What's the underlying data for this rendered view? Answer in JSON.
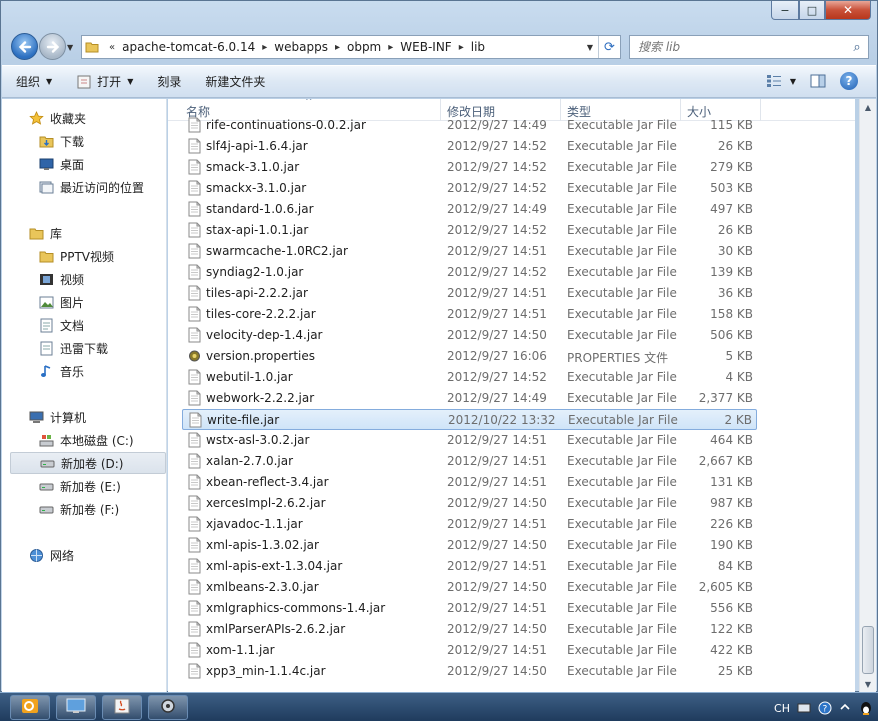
{
  "window": {
    "controls": {
      "minimize": "−",
      "maximize": "□",
      "close": "✕"
    }
  },
  "nav": {
    "back_icon": "back-arrow-icon",
    "forward_icon": "forward-arrow-icon",
    "address": {
      "overflow": "«",
      "crumbs": [
        "apache-tomcat-6.0.14",
        "webapps",
        "obpm",
        "WEB-INF",
        "lib"
      ],
      "separator": "▸"
    },
    "search_placeholder": "搜索 lib"
  },
  "toolbar": {
    "organize": "组织",
    "open": "打开",
    "burn": "刻录",
    "new_folder": "新建文件夹"
  },
  "sidebar": {
    "favorites": {
      "label": "收藏夹",
      "items": [
        "下载",
        "桌面",
        "最近访问的位置"
      ]
    },
    "libraries": {
      "label": "库",
      "items": [
        "PPTV视频",
        "视频",
        "图片",
        "文档",
        "迅雷下载",
        "音乐"
      ]
    },
    "computer": {
      "label": "计算机",
      "items": [
        "本地磁盘 (C:)",
        "新加卷 (D:)",
        "新加卷 (E:)",
        "新加卷 (F:)"
      ],
      "selected_index": 1
    },
    "network": {
      "label": "网络"
    }
  },
  "columns": {
    "name": "名称",
    "date": "修改日期",
    "type": "类型",
    "size": "大小"
  },
  "files": [
    {
      "name": "rife-continuations-0.0.2.jar",
      "date": "2012/9/27 14:49",
      "type": "Executable Jar File",
      "size": "115 KB"
    },
    {
      "name": "slf4j-api-1.6.4.jar",
      "date": "2012/9/27 14:52",
      "type": "Executable Jar File",
      "size": "26 KB"
    },
    {
      "name": "smack-3.1.0.jar",
      "date": "2012/9/27 14:52",
      "type": "Executable Jar File",
      "size": "279 KB"
    },
    {
      "name": "smackx-3.1.0.jar",
      "date": "2012/9/27 14:52",
      "type": "Executable Jar File",
      "size": "503 KB"
    },
    {
      "name": "standard-1.0.6.jar",
      "date": "2012/9/27 14:49",
      "type": "Executable Jar File",
      "size": "497 KB"
    },
    {
      "name": "stax-api-1.0.1.jar",
      "date": "2012/9/27 14:52",
      "type": "Executable Jar File",
      "size": "26 KB"
    },
    {
      "name": "swarmcache-1.0RC2.jar",
      "date": "2012/9/27 14:51",
      "type": "Executable Jar File",
      "size": "30 KB"
    },
    {
      "name": "syndiag2-1.0.jar",
      "date": "2012/9/27 14:52",
      "type": "Executable Jar File",
      "size": "139 KB"
    },
    {
      "name": "tiles-api-2.2.2.jar",
      "date": "2012/9/27 14:51",
      "type": "Executable Jar File",
      "size": "36 KB"
    },
    {
      "name": "tiles-core-2.2.2.jar",
      "date": "2012/9/27 14:51",
      "type": "Executable Jar File",
      "size": "158 KB"
    },
    {
      "name": "velocity-dep-1.4.jar",
      "date": "2012/9/27 14:50",
      "type": "Executable Jar File",
      "size": "506 KB"
    },
    {
      "name": "version.properties",
      "date": "2012/9/27 16:06",
      "type": "PROPERTIES 文件",
      "size": "5 KB",
      "icon": "properties"
    },
    {
      "name": "webutil-1.0.jar",
      "date": "2012/9/27 14:52",
      "type": "Executable Jar File",
      "size": "4 KB"
    },
    {
      "name": "webwork-2.2.2.jar",
      "date": "2012/9/27 14:49",
      "type": "Executable Jar File",
      "size": "2,377 KB"
    },
    {
      "name": "write-file.jar",
      "date": "2012/10/22 13:32",
      "type": "Executable Jar File",
      "size": "2 KB",
      "selected": true
    },
    {
      "name": "wstx-asl-3.0.2.jar",
      "date": "2012/9/27 14:51",
      "type": "Executable Jar File",
      "size": "464 KB"
    },
    {
      "name": "xalan-2.7.0.jar",
      "date": "2012/9/27 14:51",
      "type": "Executable Jar File",
      "size": "2,667 KB"
    },
    {
      "name": "xbean-reflect-3.4.jar",
      "date": "2012/9/27 14:51",
      "type": "Executable Jar File",
      "size": "131 KB"
    },
    {
      "name": "xercesImpl-2.6.2.jar",
      "date": "2012/9/27 14:50",
      "type": "Executable Jar File",
      "size": "987 KB"
    },
    {
      "name": "xjavadoc-1.1.jar",
      "date": "2012/9/27 14:51",
      "type": "Executable Jar File",
      "size": "226 KB"
    },
    {
      "name": "xml-apis-1.3.02.jar",
      "date": "2012/9/27 14:50",
      "type": "Executable Jar File",
      "size": "190 KB"
    },
    {
      "name": "xml-apis-ext-1.3.04.jar",
      "date": "2012/9/27 14:51",
      "type": "Executable Jar File",
      "size": "84 KB"
    },
    {
      "name": "xmlbeans-2.3.0.jar",
      "date": "2012/9/27 14:50",
      "type": "Executable Jar File",
      "size": "2,605 KB"
    },
    {
      "name": "xmlgraphics-commons-1.4.jar",
      "date": "2012/9/27 14:51",
      "type": "Executable Jar File",
      "size": "556 KB"
    },
    {
      "name": "xmlParserAPIs-2.6.2.jar",
      "date": "2012/9/27 14:50",
      "type": "Executable Jar File",
      "size": "122 KB"
    },
    {
      "name": "xom-1.1.jar",
      "date": "2012/9/27 14:51",
      "type": "Executable Jar File",
      "size": "422 KB"
    },
    {
      "name": "xpp3_min-1.1.4c.jar",
      "date": "2012/9/27 14:50",
      "type": "Executable Jar File",
      "size": "25 KB"
    }
  ],
  "taskbar": {
    "buttons": [
      "outlook-icon",
      "remote-desktop-icon",
      "java-icon",
      "settings-icon"
    ],
    "tray_lang": "CH"
  },
  "colors": {
    "selection_border": "#84acdd",
    "selection_fill": "#cfe4f8",
    "secondary_text": "#6d6d6d"
  }
}
